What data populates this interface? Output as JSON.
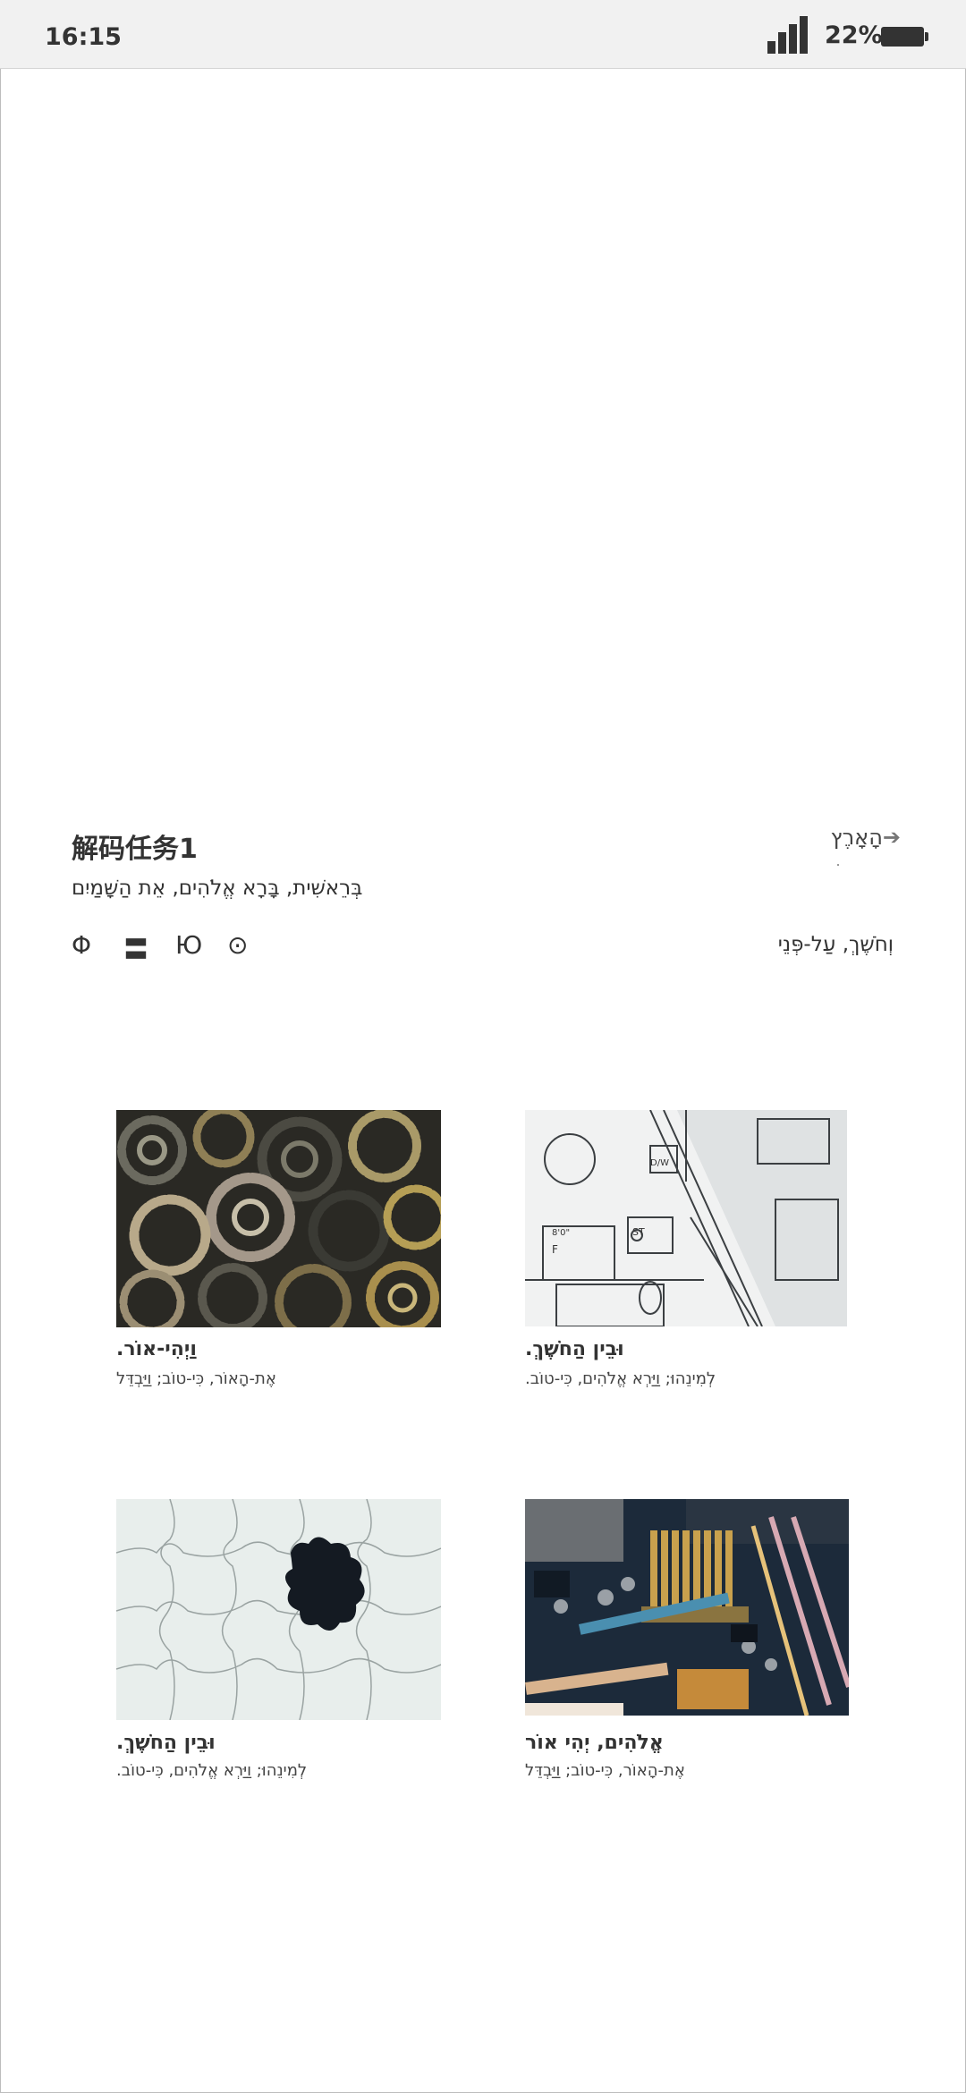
{
  "status_bar": {
    "time": "16:15",
    "battery_percent": "22%"
  },
  "header": {
    "title": "解码任务1",
    "nav_link_label": "הָאָרֶץ",
    "subtitle": "בְּרֵאשִׁית, בָּרָא אֱלֹהִים, אֵת הַשָּׁמַיִם",
    "icons": [
      "Φ",
      "〓",
      "Ю",
      "⊙"
    ],
    "right_text": "וְחֹשֶׁךְ, עַל-פְּנֵי"
  },
  "cards": [
    {
      "image": "gears-photo",
      "title": "וַיְהִי-אוֹר.",
      "subtitle": "אֶת-הָאוֹר, כִּי-טוֹב; וַיַּבְדֵּל"
    },
    {
      "image": "blueprint-photo",
      "title": "וּבֵין הַחֹשֶׁךְ.",
      "subtitle": "לְמִינֵהוּ; וַיַּרְא אֱלֹהִים, כִּי-טוֹב."
    },
    {
      "image": "puzzle-photo",
      "title": "וּבֵין הַחֹשֶׁךְ.",
      "subtitle": "לְמִינֵהוּ; וַיַּרְא אֱלֹהִים, כִּי-טוֹב."
    },
    {
      "image": "circuit-board-photo",
      "title": "אֱלֹהִים, יְהִי אוֹר",
      "subtitle": "אֶת-הָאוֹר, כִּי-טוֹב; וַיַּבְדֵּל"
    }
  ]
}
